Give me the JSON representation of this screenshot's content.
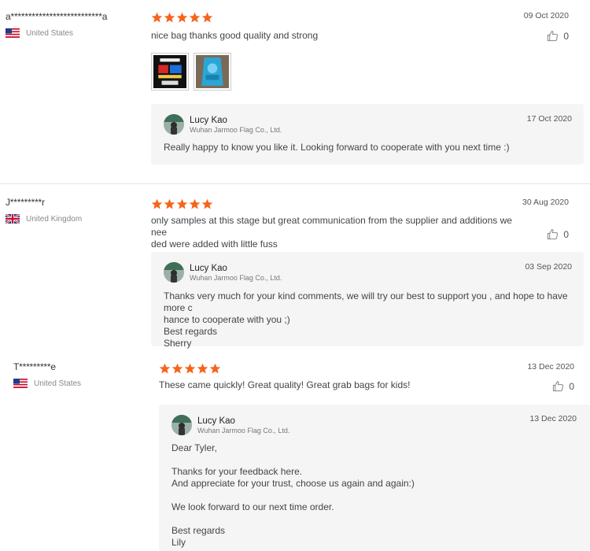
{
  "reviews": [
    {
      "user": "a**************************a",
      "country": "United States",
      "rating": 5,
      "date": "09 Oct 2020",
      "comment": "nice bag thanks good quality and strong",
      "likes": "0",
      "photos": [
        "photo-1",
        "photo-2"
      ],
      "reply": {
        "name": "Lucy Kao",
        "company": "Wuhan Jarmoo Flag Co., Ltd.",
        "date": "17 Oct 2020",
        "text": "Really happy to know you like it.  Looking forward to cooperate with you next time :)"
      }
    },
    {
      "user": "J*********r",
      "country": "United Kingdom",
      "rating": 5,
      "date": "30 Aug 2020",
      "comment": "only samples at this stage but great communication from the supplier and additions we nee\nded were added with little fuss",
      "likes": "0",
      "reply": {
        "name": "Lucy Kao",
        "company": "Wuhan Jarmoo Flag Co., Ltd.",
        "date": "03 Sep 2020",
        "text": "Thanks very much for your kind comments, we will try our best to support you , and hope to have more c\nhance to cooperate with you ;)\nBest regards\nSherry"
      }
    },
    {
      "user": "T*********e",
      "country": "United States",
      "rating": 5,
      "date": "13 Dec 2020",
      "comment": "These came quickly!  Great quality! Great grab bags for kids!",
      "likes": "0",
      "reply": {
        "name": "Lucy Kao",
        "company": "Wuhan Jarmoo Flag Co., Ltd.",
        "date": "13 Dec 2020",
        "text": "Dear Tyler,\n\nThanks for your feedback here.\nAnd appreciate for your trust, choose us again and again:)\n\nWe look forward to our next time order.\n\nBest regards\nLily"
      }
    }
  ],
  "colors": {
    "star": "#f5651b",
    "reply_bg": "#f5f5f5",
    "divider": "#e3e3e3"
  },
  "icons": {
    "star": "star-icon",
    "like": "thumbs-up-icon",
    "flag_us": "us-flag-icon",
    "flag_uk": "uk-flag-icon"
  }
}
